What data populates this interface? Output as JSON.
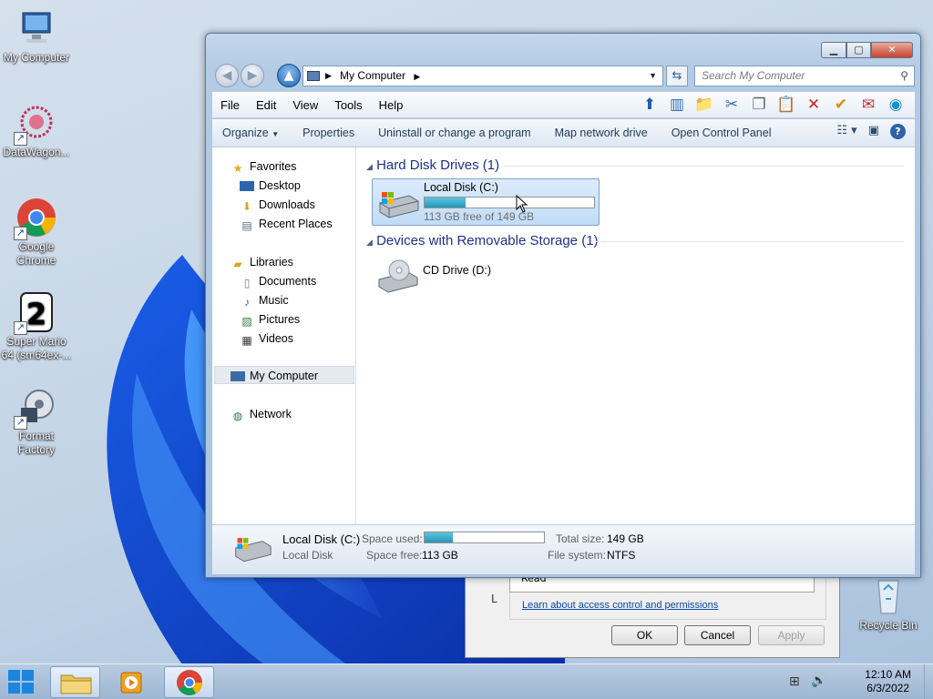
{
  "desktop": {
    "icons": [
      {
        "label": "My Computer"
      },
      {
        "label": "DataWagon..."
      },
      {
        "label": "Google Chrome"
      },
      {
        "label": "Super Mario 64 (sm64ex-..."
      },
      {
        "label": "Format Factory"
      },
      {
        "label": "Recycle Bin"
      }
    ]
  },
  "background_dialog": {
    "list_item": "Read",
    "link": "Learn about access control and permissions",
    "left_char": "L",
    "buttons": {
      "ok": "OK",
      "cancel": "Cancel",
      "apply": "Apply"
    }
  },
  "explorer": {
    "address": {
      "crumb": "My Computer"
    },
    "search_placeholder": "Search My Computer",
    "menu": [
      "File",
      "Edit",
      "View",
      "Tools",
      "Help"
    ],
    "commands": [
      "Organize",
      "Properties",
      "Uninstall or change a program",
      "Map network drive",
      "Open Control Panel"
    ],
    "nav": {
      "favorites": "Favorites",
      "favorites_items": [
        "Desktop",
        "Downloads",
        "Recent Places"
      ],
      "libraries": "Libraries",
      "libraries_items": [
        "Documents",
        "Music",
        "Pictures",
        "Videos"
      ],
      "computer": "My Computer",
      "network": "Network"
    },
    "groups": {
      "hdd": "Hard Disk Drives (1)",
      "removable": "Devices with Removable Storage (1)"
    },
    "drives": {
      "c_name": "Local Disk (C:)",
      "c_free": "113 GB free of 149 GB",
      "c_used_fraction": 0.24,
      "d_name": "CD Drive (D:)"
    },
    "details": {
      "name": "Local Disk (C:)",
      "type": "Local Disk",
      "space_used_label": "Space used:",
      "space_free_label": "Space free:",
      "space_free": "113 GB",
      "total_size_label": "Total size:",
      "total_size": "149 GB",
      "file_system_label": "File system:",
      "file_system": "NTFS"
    }
  },
  "taskbar": {
    "time": "12:10 AM",
    "date": "6/3/2022"
  },
  "colors": {
    "accent": "#1e3287",
    "progress": "#2697b8"
  }
}
